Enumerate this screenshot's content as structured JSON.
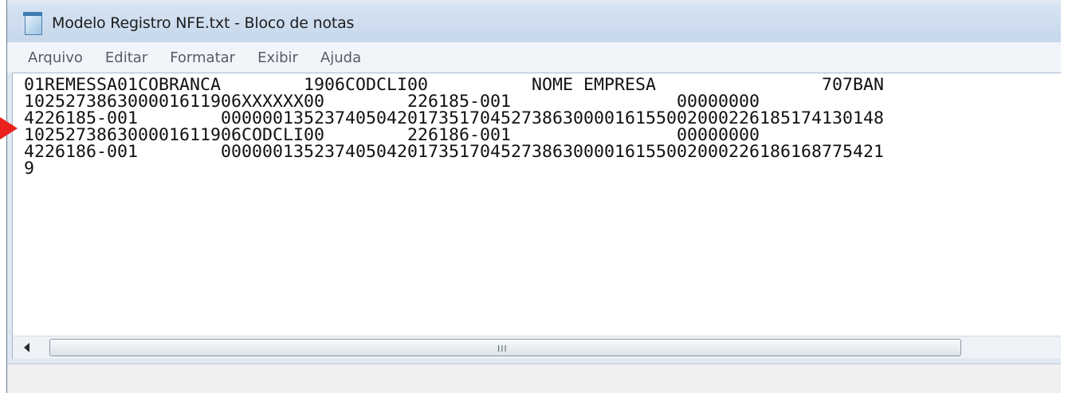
{
  "window": {
    "title": "Modelo Registro NFE.txt - Bloco de notas"
  },
  "menu": {
    "items": [
      "Arquivo",
      "Editar",
      "Formatar",
      "Exibir",
      "Ajuda"
    ]
  },
  "editor": {
    "lines": [
      "01REMESSA01COBRANCA        1906CODCLI00          NOME EMPRESA                707BAN",
      "102527386300001611906XXXXXX00        226185-001                00000000",
      "4226185-001        0000001352374050420173517045273863000016155002000226185174130148",
      "102527386300001611906CODCLI00        226186-001                00000000",
      "4226186-001        0000001352374050420173517045273863000016155002000226186168775421",
      "9"
    ]
  },
  "scrollbar": {
    "grip": "III"
  },
  "annotation": {
    "arrow_color": "#e8211d"
  }
}
